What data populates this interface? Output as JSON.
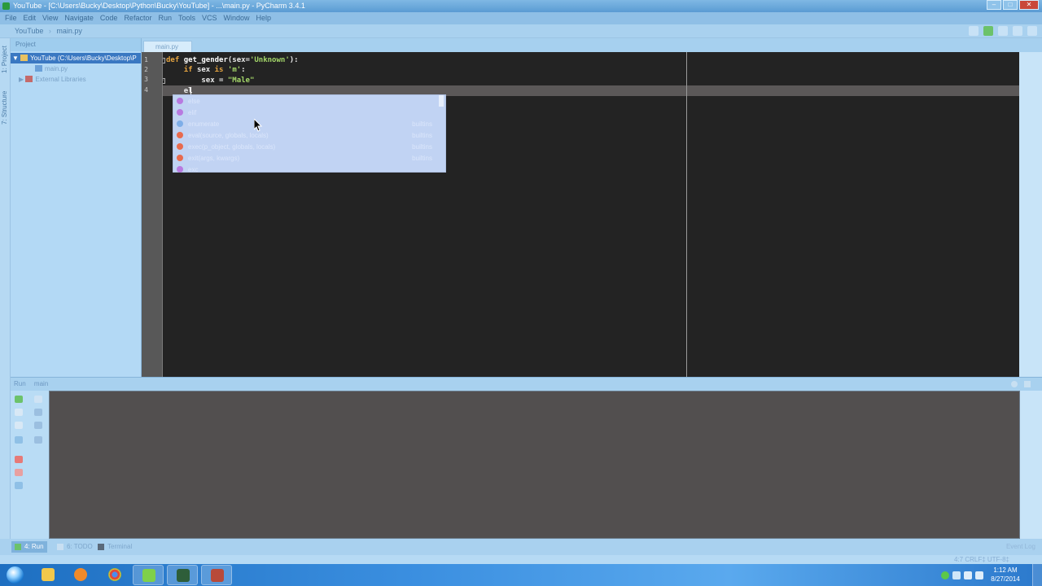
{
  "window": {
    "title": "YouTube - [C:\\Users\\Bucky\\Desktop\\Python\\Bucky\\YouTube] - ...\\main.py - PyCharm 3.4.1"
  },
  "menu": [
    "File",
    "Edit",
    "View",
    "Navigate",
    "Code",
    "Refactor",
    "Run",
    "Tools",
    "VCS",
    "Window",
    "Help"
  ],
  "navbar": {
    "project": "YouTube",
    "file": "main.py"
  },
  "project_panel": {
    "header": "Project",
    "tree": [
      {
        "label": "YouTube (C:\\Users\\Bucky\\Desktop\\P",
        "selected": true,
        "indent": 0,
        "arrow": "▼"
      },
      {
        "label": "main.py",
        "selected": false,
        "indent": 2,
        "arrow": ""
      },
      {
        "label": "External Libraries",
        "selected": false,
        "indent": 1,
        "arrow": "▶"
      }
    ]
  },
  "left_strip": {
    "project_tab": "1: Project",
    "structure_tab": "7: Structure"
  },
  "editor": {
    "tab_label": "main.py",
    "line_numbers": [
      "1",
      "2",
      "3",
      "4"
    ],
    "lines": {
      "l1": {
        "kw": "def ",
        "name": "get_gender",
        "open": "(sex=",
        "str": "'Unknown'",
        "close": "):"
      },
      "l2": {
        "indent": "    ",
        "kw": "if ",
        "var": "sex ",
        "kw2": "is ",
        "str": "'m'",
        "close": ":"
      },
      "l3": {
        "indent": "        ",
        "var": "sex = ",
        "str": "\"Male\""
      },
      "l4": {
        "indent": "    ",
        "typed": "el"
      }
    }
  },
  "autocomplete": {
    "items": [
      {
        "label": "else",
        "tail": "",
        "kind": "k"
      },
      {
        "label": "elif",
        "tail": "",
        "kind": "k"
      },
      {
        "label": "enumerate",
        "tail": "builtins",
        "kind": "c"
      },
      {
        "label": "eval(source, globals, locals)",
        "tail": "builtins",
        "kind": "f"
      },
      {
        "label": "exec(p_object, globals, locals)",
        "tail": "builtins",
        "kind": "f"
      },
      {
        "label": "exit(args, kwargs)",
        "tail": "builtins",
        "kind": "f"
      },
      {
        "label": "exc",
        "tail": "",
        "kind": "k"
      }
    ]
  },
  "run_panel": {
    "header": "Run",
    "tab": "main"
  },
  "bottom_tabs": {
    "run": "4: Run",
    "todo": "6: TODO",
    "terminal": "Terminal",
    "event_log": "Event Log"
  },
  "status_bar": {
    "position": "4:7  CRLF‡  UTF-8‡"
  },
  "taskbar": {
    "clock_time": "1:12 AM",
    "clock_date": "8/27/2014",
    "apps": [
      "explorer-icon",
      "media-player-icon",
      "chrome-icon",
      "pycharm-icon",
      "terminal-icon",
      "pycharm-console-icon"
    ]
  },
  "colors": {
    "editor_bg": "#232323",
    "keyword": "#e6a540",
    "string": "#a5d86a",
    "popup_bg": "#c1d3f3",
    "console_bg": "#524f4f",
    "selected_tree": "#3a78c2"
  }
}
